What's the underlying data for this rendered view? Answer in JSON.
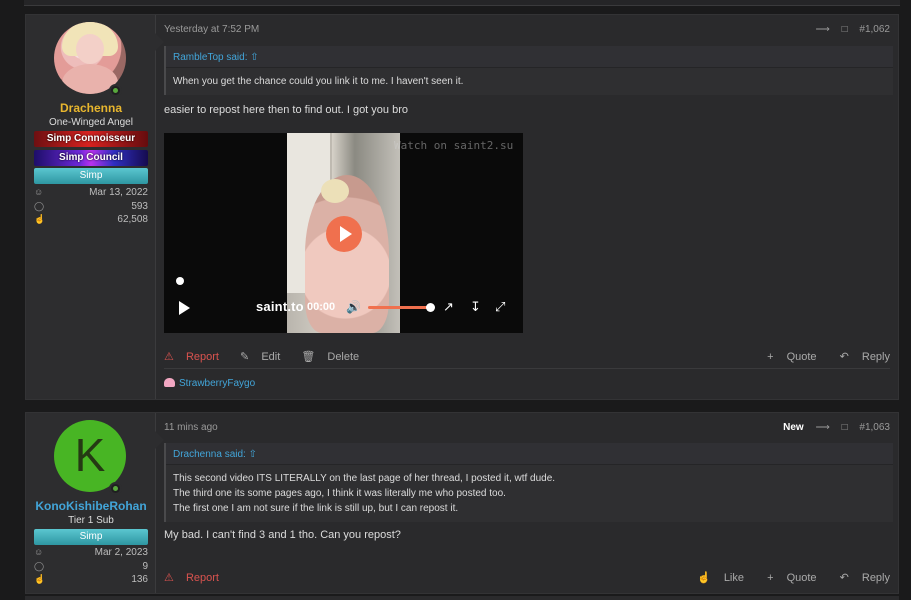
{
  "posts": [
    {
      "author": "Drachenna",
      "author_color": "#e8b62e",
      "user_title": "One-Winged Angel",
      "banners": [
        "Simp Connoisseur",
        "Simp Council",
        "Simp"
      ],
      "stats": {
        "joined": "Mar 13, 2022",
        "messages": "593",
        "reactions": "62,508"
      },
      "timestamp": "Yesterday at 7:52 PM",
      "post_number": "#1,062",
      "quote_author": "RambleTop said:",
      "quote_lines": [
        "When you get the chance could you link it to me. I haven't seen it."
      ],
      "message": "easier to repost here then to find out. I got you bro",
      "video": {
        "watermark": "Watch on saint2.su",
        "brand": "saint.to",
        "time": "00:00",
        "volume_level": 1.0
      },
      "actions_left": [
        "Report",
        "Edit",
        "Delete"
      ],
      "actions_right": [
        "Quote",
        "Reply"
      ],
      "reaction_user": "StrawberryFaygo"
    },
    {
      "author": "KonoKishibeRohan",
      "author_color": "#42a5d9",
      "avatar_letter": "K",
      "user_title": "Tier 1 Sub",
      "banners": [
        "Simp"
      ],
      "stats": {
        "joined": "Mar 2, 2023",
        "messages": "9",
        "reactions": "136"
      },
      "timestamp": "11 mins ago",
      "badge": "New",
      "post_number": "#1,063",
      "quote_author": "Drachenna said:",
      "quote_lines": [
        "This second video ITS LITERALLY on the last page of her thread, I posted it, wtf dude.",
        "The third one its some pages ago, I think it was literally me who posted too.",
        "The first one I am not sure if the link is still up, but I can repost it."
      ],
      "message": "My bad. I can't find 3 and 1 tho. Can you repost?",
      "actions_left": [
        "Report"
      ],
      "actions_right": [
        "Like",
        "Quote",
        "Reply"
      ]
    }
  ],
  "icons": {
    "share": "share-icon",
    "bookmark": "bookmark-icon",
    "joined": "user-icon",
    "messages": "comment-icon",
    "reactions": "thumbs-up-icon",
    "report": "warning-circle-icon",
    "edit": "pencil-icon",
    "delete": "trash-icon",
    "quote": "plus-icon",
    "reply": "reply-icon",
    "like": "thumbs-up-icon",
    "quote_jump": "arrow-up-circle-icon",
    "video_play": "play-icon"
  }
}
